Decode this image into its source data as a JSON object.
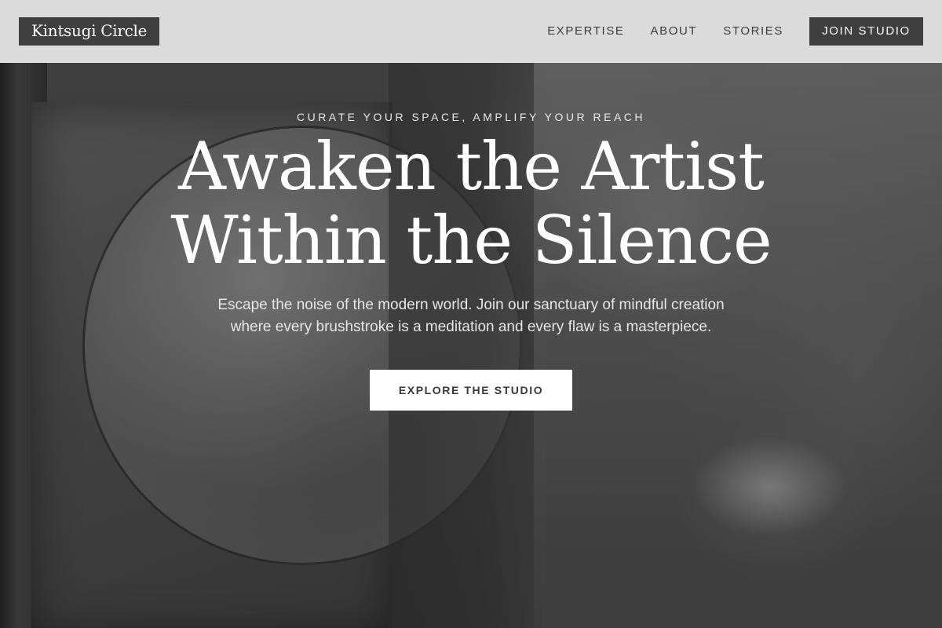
{
  "header": {
    "logo": "Kintsugi Circle",
    "nav": [
      {
        "label": "EXPERTISE"
      },
      {
        "label": "ABOUT"
      },
      {
        "label": "STORIES"
      }
    ],
    "cta_label": "JOIN STUDIO"
  },
  "hero": {
    "eyebrow": "CURATE YOUR SPACE, AMPLIFY YOUR REACH",
    "headline": "Awaken the Artist Within the Silence",
    "subtext": "Escape the noise of the modern world. Join our sanctuary of mindful creation where every brushstroke is a meditation and every flaw is a masterpiece.",
    "button_label": "EXPLORE THE STUDIO"
  },
  "colors": {
    "header_bg": "#e8e8e8",
    "dark_accent": "#3f3f3f",
    "button_bg": "#ffffff"
  }
}
